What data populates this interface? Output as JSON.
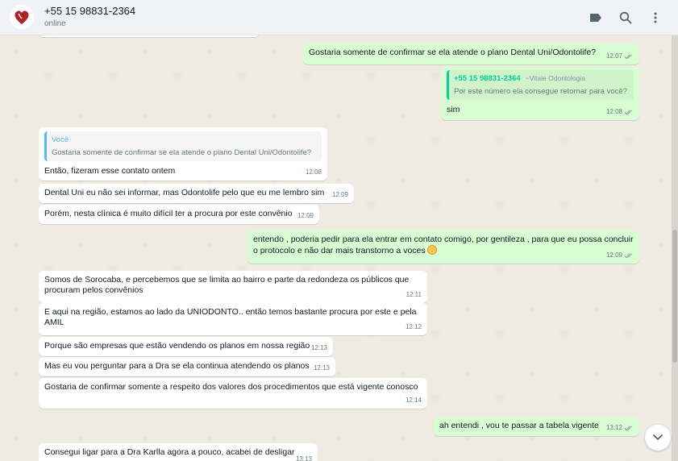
{
  "header": {
    "contact_name": "+55 15 98831-2364",
    "status": "online",
    "icons": [
      "label-icon",
      "search-icon",
      "menu-icon"
    ]
  },
  "colors": {
    "incoming": "#ffffff",
    "outgoing": "#d9fdd3",
    "quote_blue": "#53bdeb",
    "quote_green": "#06cf9c",
    "read_ticks": "#8696a0"
  },
  "messages": [
    {
      "text": "Gostaria somente de confirmar se ela atende o plano Dental Uni/Odontolife?",
      "time": "12:07"
    },
    {
      "quote_author": "+55 15 98831-2364",
      "quote_sub": "~Vitale Odontologia",
      "quote_text": "Por este número ela consegue retornar para você?",
      "text": "sim",
      "time": "12:08"
    },
    {
      "quote_author": "Você",
      "quote_text": "Gostaria somente de confirmar se ela atende o plano Dental Uni/Odontolife?",
      "text": "Então, fizeram esse contato ontem",
      "time": "12:08"
    },
    {
      "text": "Dental Uni eu não sei informar, mas Odontolife pelo que eu me lembro sim",
      "time": "12:09"
    },
    {
      "text": "Porém, nesta clínica é muito difícil ter a procura por este convênio",
      "time": "12:09"
    },
    {
      "text": "entendo , poderia pedir para ela entrar em contato comigo, por gentileza , para que eu possa concluir o protocolo e não dar mais transtorno a voces",
      "time": "12:09"
    },
    {
      "text": "Somos de Sorocaba, e percebemos que se limita ao bairro e parte da redondeza os públicos que procuram pelos convênios",
      "time": "12:11"
    },
    {
      "text": "E aqui na região, estamos ao lado da UNIODONTO.. então temos bastante procura por este e pela AMIL",
      "time": "12:12"
    },
    {
      "text": "Porque são empresas que estão vendendo os planos em nossa região",
      "time": "12:13"
    },
    {
      "text": "Mas eu vou perguntar para a Dra se ela continua atendendo os planos",
      "time": "12:13"
    },
    {
      "text": "Gostaria de confirmar somente a respeito dos valores dos procedimentos que está vigente conosco",
      "time": "12:14"
    },
    {
      "text": "ah entendi , vou te passar a tabela vigente",
      "time": "13:12"
    },
    {
      "text": "Consegui ligar para a Dra Karlla agora a pouco, acabei de desligar",
      "time": "13:13"
    }
  ]
}
